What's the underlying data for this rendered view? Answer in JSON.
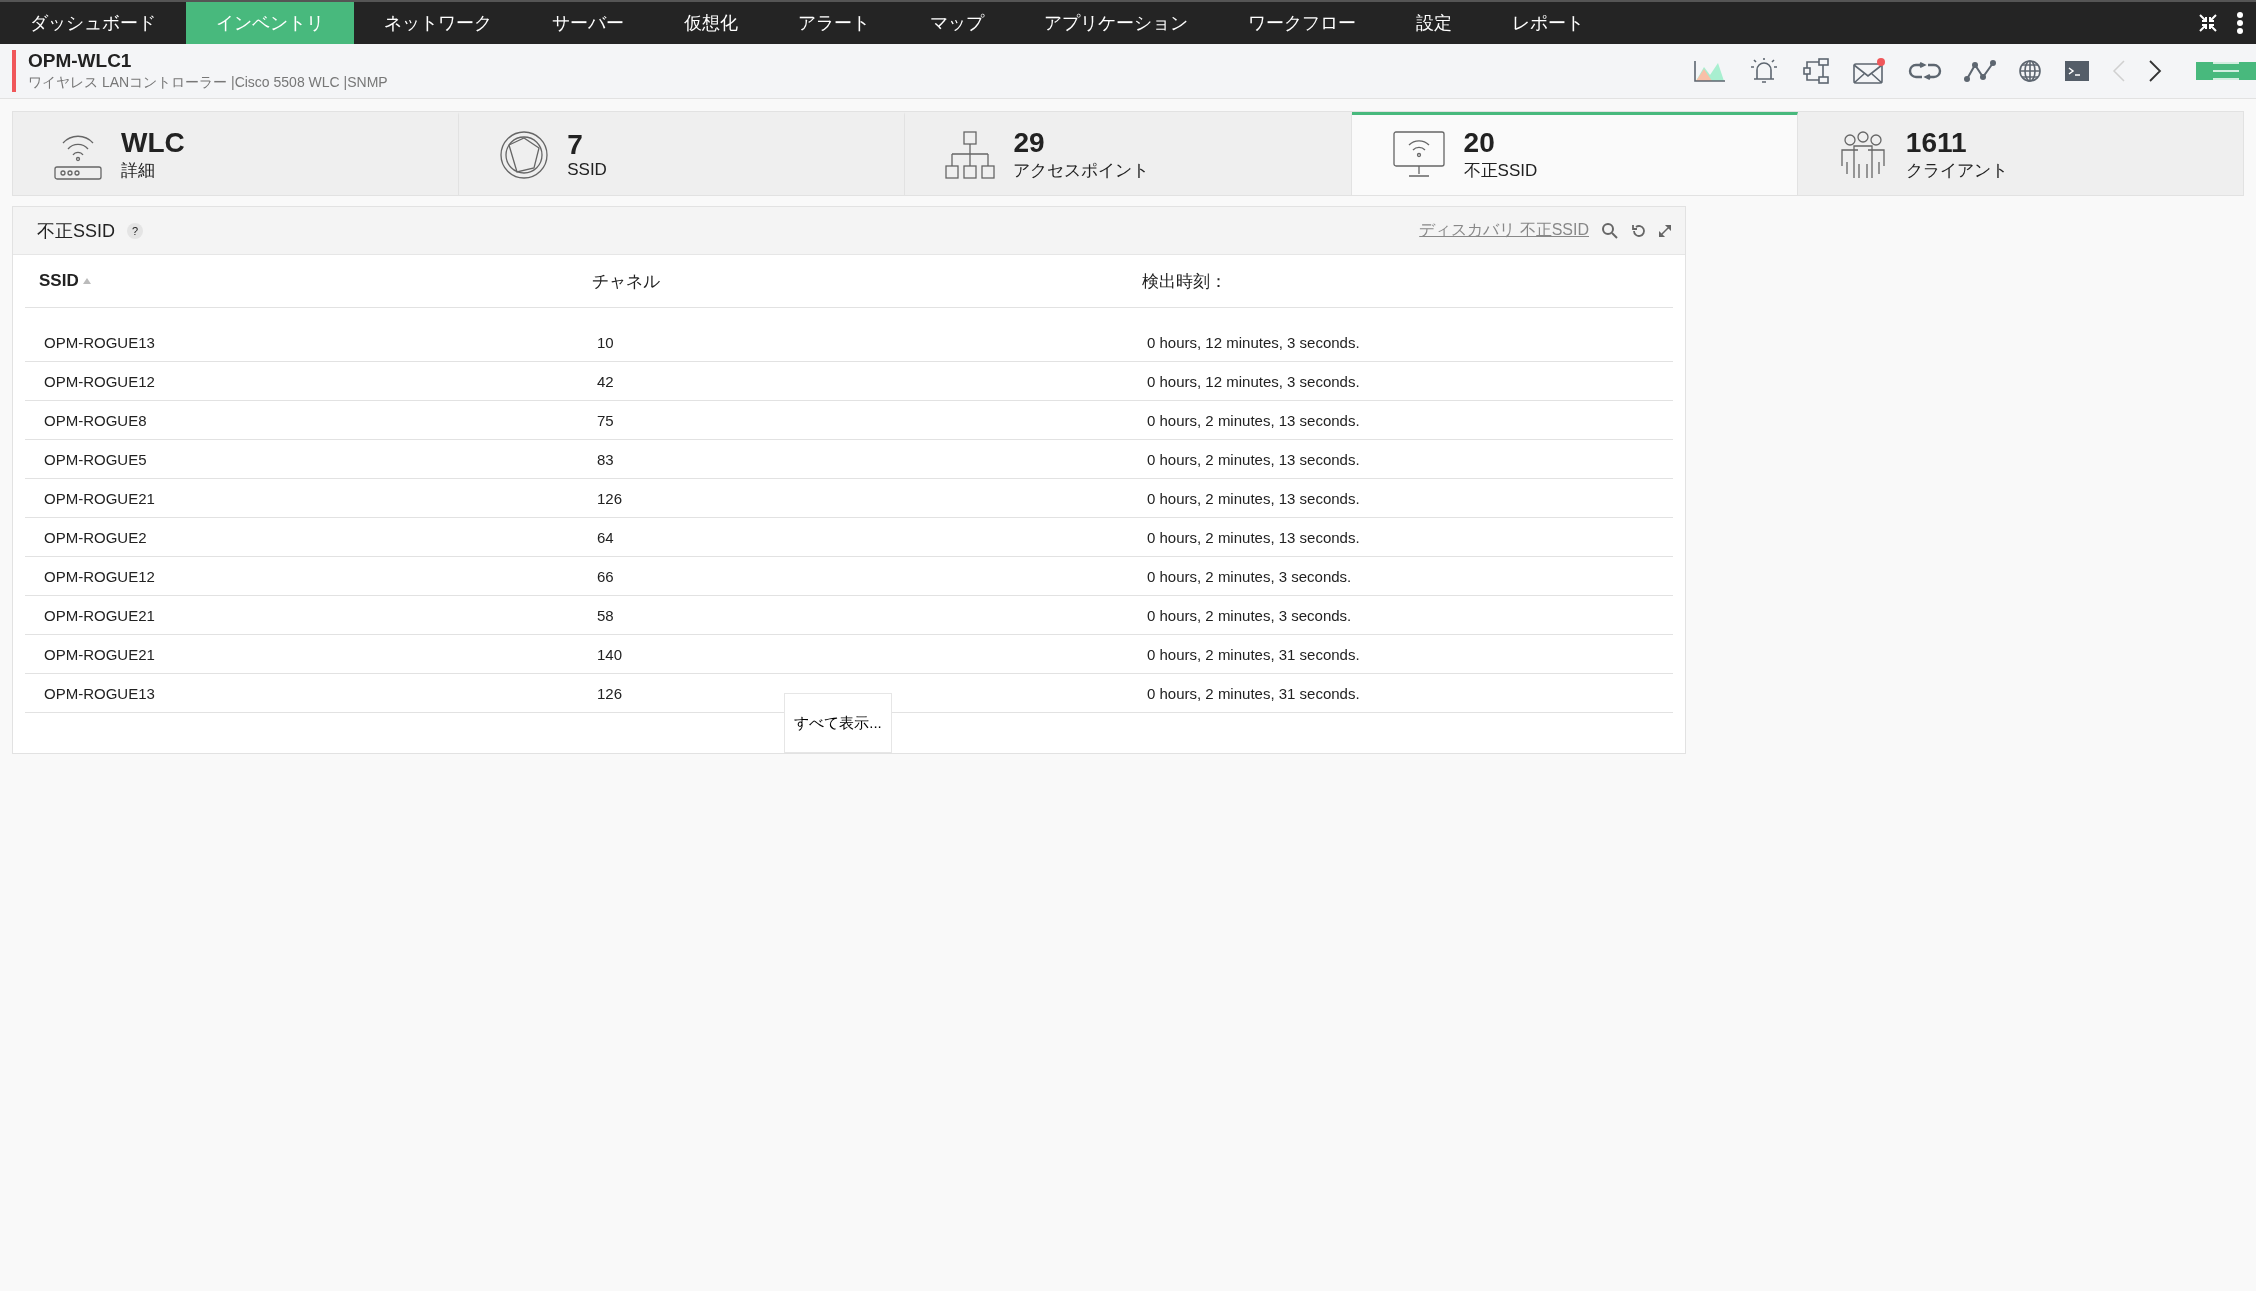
{
  "nav": {
    "items": [
      {
        "label": "ダッシュボード",
        "selected": false
      },
      {
        "label": "インベントリ",
        "selected": true
      },
      {
        "label": "ネットワーク",
        "selected": false
      },
      {
        "label": "サーバー",
        "selected": false
      },
      {
        "label": "仮想化",
        "selected": false
      },
      {
        "label": "アラート",
        "selected": false
      },
      {
        "label": "マップ",
        "selected": false
      },
      {
        "label": "アプリケーション",
        "selected": false
      },
      {
        "label": "ワークフロー",
        "selected": false
      },
      {
        "label": "設定",
        "selected": false
      },
      {
        "label": "レポート",
        "selected": false
      }
    ]
  },
  "device": {
    "name": "OPM-WLC1",
    "subtitle": "ワイヤレス LANコントローラー |Cisco 5508 WLC |SNMP"
  },
  "toolbar": {
    "mail_unread": true,
    "prev_disabled": true
  },
  "tiles": [
    {
      "kind": "wlc",
      "value": "WLC",
      "label": "詳細",
      "selected": false
    },
    {
      "kind": "ssid",
      "value": "7",
      "label": "SSID",
      "selected": false
    },
    {
      "kind": "ap",
      "value": "29",
      "label": "アクセスポイント",
      "selected": false
    },
    {
      "kind": "rogue",
      "value": "20",
      "label": "不正SSID",
      "selected": true
    },
    {
      "kind": "clients",
      "value": "1611",
      "label": "クライアント",
      "selected": false
    }
  ],
  "panel": {
    "title": "不正SSID",
    "help": "?",
    "discover_link": "ディスカバリ 不正SSID",
    "columns": [
      "SSID",
      "チャネル",
      "検出時刻："
    ],
    "rows": [
      [
        "OPM-ROGUE13",
        "10",
        "0 hours, 12 minutes, 3 seconds."
      ],
      [
        "OPM-ROGUE12",
        "42",
        "0 hours, 12 minutes, 3 seconds."
      ],
      [
        "OPM-ROGUE8",
        "75",
        "0 hours, 2 minutes, 13 seconds."
      ],
      [
        "OPM-ROGUE5",
        "83",
        "0 hours, 2 minutes, 13 seconds."
      ],
      [
        "OPM-ROGUE21",
        "126",
        "0 hours, 2 minutes, 13 seconds."
      ],
      [
        "OPM-ROGUE2",
        "64",
        "0 hours, 2 minutes, 13 seconds."
      ],
      [
        "OPM-ROGUE12",
        "66",
        "0 hours, 2 minutes, 3 seconds."
      ],
      [
        "OPM-ROGUE21",
        "58",
        "0 hours, 2 minutes, 3 seconds."
      ],
      [
        "OPM-ROGUE21",
        "140",
        "0 hours, 2 minutes, 31 seconds."
      ],
      [
        "OPM-ROGUE13",
        "126",
        "0 hours, 2 minutes, 31 seconds."
      ]
    ],
    "show_all": "すべて表示..."
  }
}
